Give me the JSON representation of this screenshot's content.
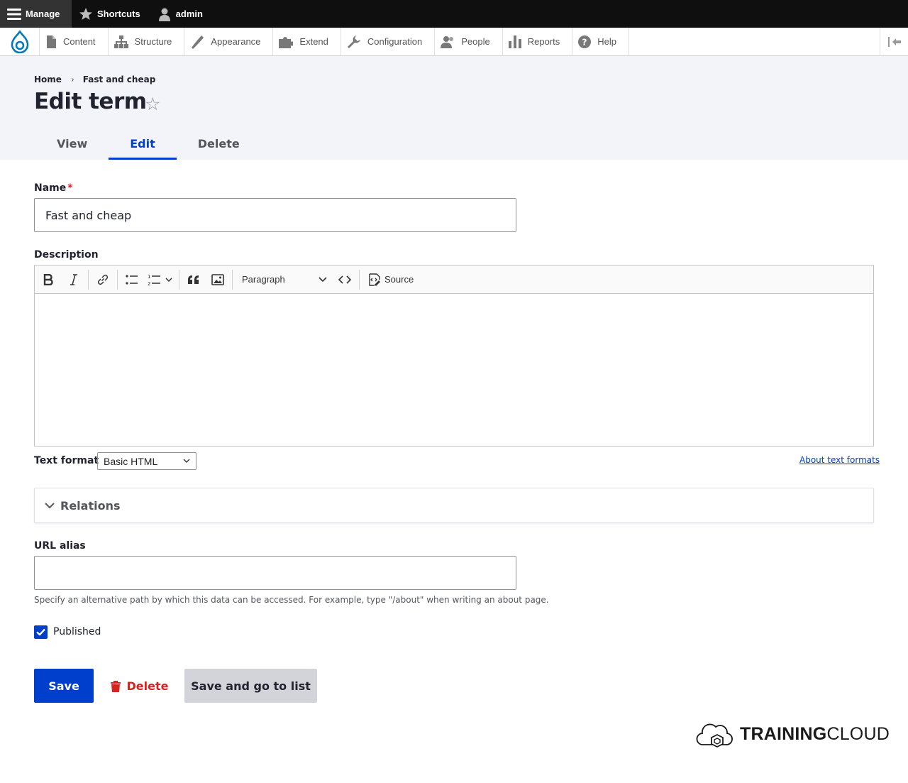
{
  "toolbar": {
    "manage": "Manage",
    "shortcuts": "Shortcuts",
    "user": "admin"
  },
  "tray": {
    "items": [
      {
        "label": "Content",
        "icon": "document-icon"
      },
      {
        "label": "Structure",
        "icon": "sitemap-icon"
      },
      {
        "label": "Appearance",
        "icon": "paintbrush-icon"
      },
      {
        "label": "Extend",
        "icon": "puzzle-icon"
      },
      {
        "label": "Configuration",
        "icon": "wrench-icon"
      },
      {
        "label": "People",
        "icon": "people-icon"
      },
      {
        "label": "Reports",
        "icon": "bar-chart-icon"
      },
      {
        "label": "Help",
        "icon": "help-icon"
      }
    ]
  },
  "breadcrumb": {
    "home": "Home",
    "current": "Fast and cheap"
  },
  "page": {
    "title": "Edit term"
  },
  "tabs": {
    "view": "View",
    "edit": "Edit",
    "delete": "Delete"
  },
  "form": {
    "name_label": "Name",
    "name_required": "*",
    "name_value": "Fast and cheap",
    "description_label": "Description",
    "editor": {
      "paragraph": "Paragraph",
      "source": "Source"
    },
    "text_format_label": "Text format",
    "text_format_value": "Basic HTML",
    "about_formats": "About text formats",
    "relations_label": "Relations",
    "url_alias_label": "URL alias",
    "url_alias_value": "",
    "url_alias_hint": "Specify an alternative path by which this data can be accessed. For example, type \"/about\" when writing an about page.",
    "published_label": "Published",
    "published_checked": true
  },
  "actions": {
    "save": "Save",
    "delete": "Delete",
    "save_list": "Save and go to list"
  },
  "brand": {
    "bold": "TRAINING",
    "light": "CLOUD"
  },
  "colors": {
    "accent": "#003ecc",
    "danger": "#d72222",
    "header_bg": "#f3f4f9",
    "toolbar_bg": "#0f0f0f"
  }
}
